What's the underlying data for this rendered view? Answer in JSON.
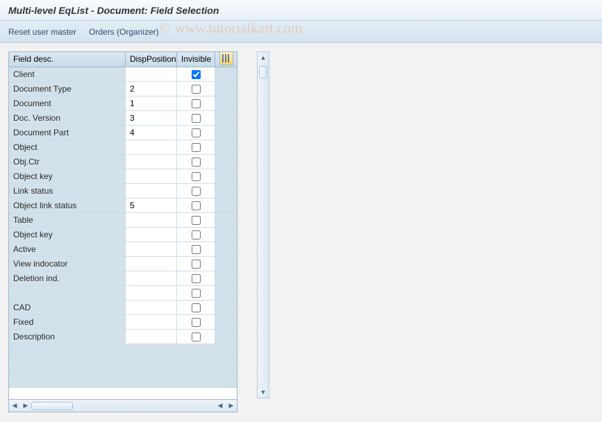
{
  "title": "Multi-level EqList - Document: Field Selection",
  "toolbar": {
    "reset_label": "Reset user master",
    "orders_label": "Orders (Organizer)"
  },
  "watermark": "© www.tutorialkart.com",
  "table": {
    "headers": {
      "field_desc": "Field desc.",
      "disp_position": "DispPosition",
      "invisible": "Invisible"
    },
    "rows": [
      {
        "desc": "Client",
        "disp": "",
        "invisible": true
      },
      {
        "desc": "Document Type",
        "disp": "2",
        "invisible": false
      },
      {
        "desc": "Document",
        "disp": "1",
        "invisible": false
      },
      {
        "desc": "Doc. Version",
        "disp": "3",
        "invisible": false
      },
      {
        "desc": "Document Part",
        "disp": "4",
        "invisible": false
      },
      {
        "desc": "Object",
        "disp": "",
        "invisible": false
      },
      {
        "desc": "Obj.Ctr",
        "disp": "",
        "invisible": false
      },
      {
        "desc": "Object key",
        "disp": "",
        "invisible": false
      },
      {
        "desc": "Link status",
        "disp": "",
        "invisible": false
      },
      {
        "desc": "Object link status",
        "disp": "5",
        "invisible": false
      },
      {
        "desc": "Table",
        "disp": "",
        "invisible": false
      },
      {
        "desc": "Object key",
        "disp": "",
        "invisible": false
      },
      {
        "desc": "Active",
        "disp": "",
        "invisible": false
      },
      {
        "desc": "View indocator",
        "disp": "",
        "invisible": false
      },
      {
        "desc": "Deletion ind.",
        "disp": "",
        "invisible": false
      },
      {
        "desc": "",
        "disp": "",
        "invisible": false
      },
      {
        "desc": "CAD",
        "disp": "",
        "invisible": false
      },
      {
        "desc": "Fixed",
        "disp": "",
        "invisible": false
      },
      {
        "desc": "Description",
        "disp": "",
        "invisible": false
      }
    ],
    "empty_rows": 3
  }
}
